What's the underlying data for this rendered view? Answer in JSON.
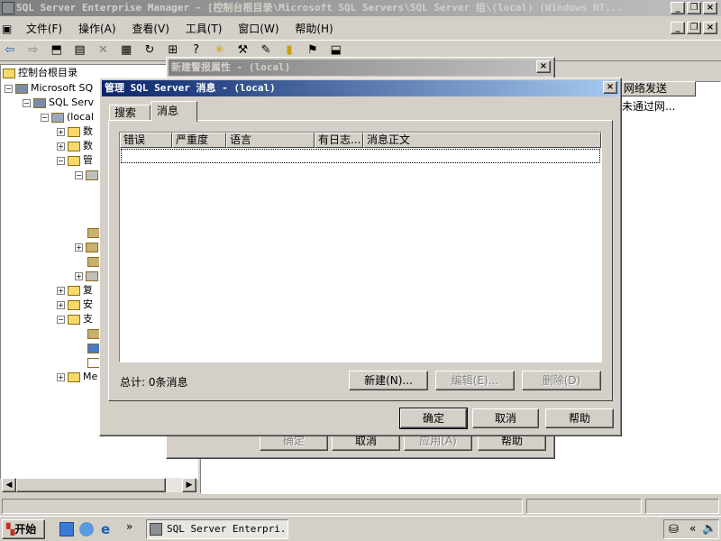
{
  "main_window": {
    "title": "SQL Server Enterprise Manager - [控制台根目录\\Microsoft SQL Servers\\SQL Server 组\\(local) (Windows NT...",
    "menu": [
      "文件(F)",
      "操作(A)",
      "查看(V)",
      "工具(T)",
      "窗口(W)",
      "帮助(H)"
    ]
  },
  "tree": {
    "root": "控制台根目录",
    "ms_sql": "Microsoft SQ",
    "group": "SQL Serv",
    "local": "(local",
    "n1": "数",
    "n2": "数",
    "n3": "管",
    "n4": "复",
    "n5": "安",
    "n6": "支",
    "n7": "Me"
  },
  "right_pane": {
    "column": "网络发送",
    "value": "未通过网..."
  },
  "alert_dialog": {
    "title": "新建警报属性 - (local)",
    "buttons": [
      "确定",
      "取消",
      "应用(A)",
      "帮助"
    ]
  },
  "messages_dialog": {
    "title": "管理 SQL Server 消息 - (local)",
    "tabs": [
      "搜索",
      "消息"
    ],
    "columns": [
      "错误",
      "严重度",
      "语言",
      "有日志...",
      "消息正文"
    ],
    "total": "总计: 0条消息",
    "new_button": "新建(N)...",
    "edit_button": "编辑(E)...",
    "delete_button": "删除(D)",
    "ok": "确定",
    "cancel": "取消",
    "help": "帮助"
  },
  "taskbar": {
    "start": "开始",
    "task": "SQL Server Enterpri...",
    "chevron": "»",
    "tray_chevron": "«"
  }
}
